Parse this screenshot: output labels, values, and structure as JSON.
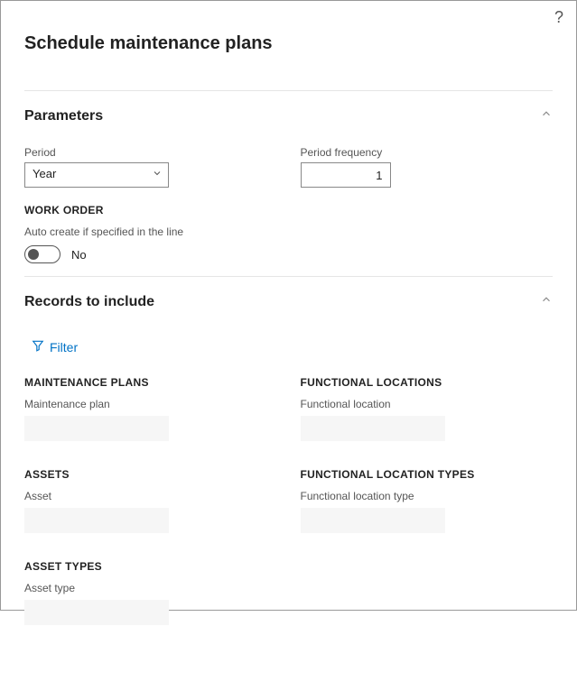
{
  "dialog": {
    "title": "Schedule maintenance plans"
  },
  "parameters": {
    "section_title": "Parameters",
    "period": {
      "label": "Period",
      "value": "Year"
    },
    "period_frequency": {
      "label": "Period frequency",
      "value": "1"
    },
    "work_order": {
      "header": "WORK ORDER",
      "auto_create_label": "Auto create if specified in the line",
      "auto_create_value": "No"
    }
  },
  "records": {
    "section_title": "Records to include",
    "filter_label": "Filter",
    "groups": {
      "maintenance_plans": {
        "header": "MAINTENANCE PLANS",
        "field_label": "Maintenance plan"
      },
      "functional_locations": {
        "header": "FUNCTIONAL LOCATIONS",
        "field_label": "Functional location"
      },
      "assets": {
        "header": "ASSETS",
        "field_label": "Asset"
      },
      "functional_location_types": {
        "header": "FUNCTIONAL LOCATION TYPES",
        "field_label": "Functional location type"
      },
      "asset_types": {
        "header": "ASSET TYPES",
        "field_label": "Asset type"
      }
    }
  }
}
